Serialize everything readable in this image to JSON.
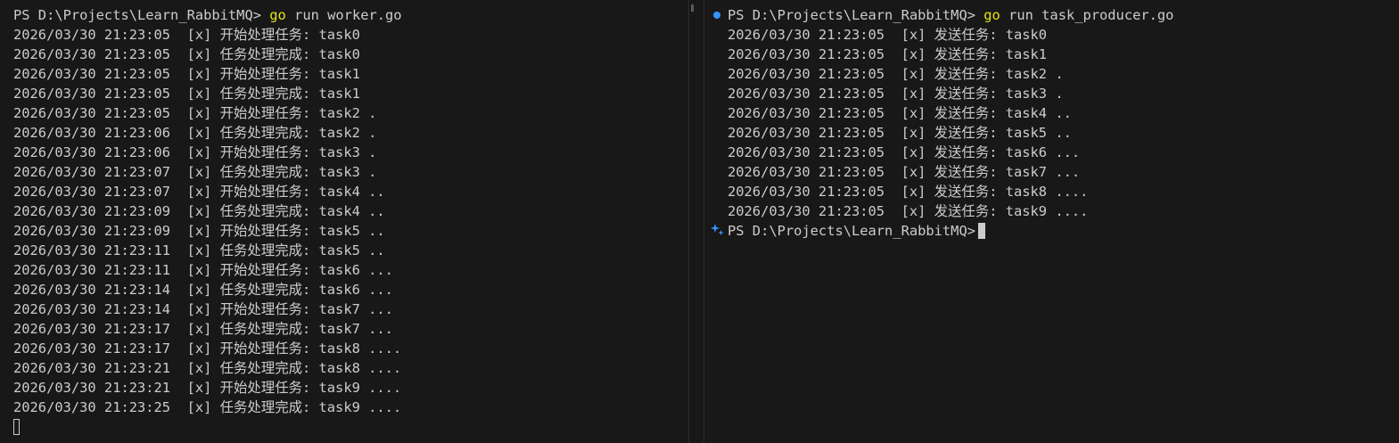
{
  "left_terminal": {
    "prompt": "PS D:\\Projects\\Learn_RabbitMQ>",
    "command": "go",
    "command_args": "run worker.go",
    "output": [
      "2026/03/30 21:23:05  [x] 开始处理任务: task0",
      "2026/03/30 21:23:05  [x] 任务处理完成: task0",
      "2026/03/30 21:23:05  [x] 开始处理任务: task1",
      "2026/03/30 21:23:05  [x] 任务处理完成: task1",
      "2026/03/30 21:23:05  [x] 开始处理任务: task2 .",
      "2026/03/30 21:23:06  [x] 任务处理完成: task2 .",
      "2026/03/30 21:23:06  [x] 开始处理任务: task3 .",
      "2026/03/30 21:23:07  [x] 任务处理完成: task3 .",
      "2026/03/30 21:23:07  [x] 开始处理任务: task4 ..",
      "2026/03/30 21:23:09  [x] 任务处理完成: task4 ..",
      "2026/03/30 21:23:09  [x] 开始处理任务: task5 ..",
      "2026/03/30 21:23:11  [x] 任务处理完成: task5 ..",
      "2026/03/30 21:23:11  [x] 开始处理任务: task6 ...",
      "2026/03/30 21:23:14  [x] 任务处理完成: task6 ...",
      "2026/03/30 21:23:14  [x] 开始处理任务: task7 ...",
      "2026/03/30 21:23:17  [x] 任务处理完成: task7 ...",
      "2026/03/30 21:23:17  [x] 开始处理任务: task8 ....",
      "2026/03/30 21:23:21  [x] 任务处理完成: task8 ....",
      "2026/03/30 21:23:21  [x] 开始处理任务: task9 ....",
      "2026/03/30 21:23:25  [x] 任务处理完成: task9 ...."
    ]
  },
  "right_terminal": {
    "prompt": "PS D:\\Projects\\Learn_RabbitMQ>",
    "command": "go",
    "command_args": "run task_producer.go",
    "output": [
      "2026/03/30 21:23:05  [x] 发送任务: task0",
      "2026/03/30 21:23:05  [x] 发送任务: task1",
      "2026/03/30 21:23:05  [x] 发送任务: task2 .",
      "2026/03/30 21:23:05  [x] 发送任务: task3 .",
      "2026/03/30 21:23:05  [x] 发送任务: task4 ..",
      "2026/03/30 21:23:05  [x] 发送任务: task5 ..",
      "2026/03/30 21:23:05  [x] 发送任务: task6 ...",
      "2026/03/30 21:23:05  [x] 发送任务: task7 ...",
      "2026/03/30 21:23:05  [x] 发送任务: task8 ....",
      "2026/03/30 21:23:05  [x] 发送任务: task9 ...."
    ],
    "final_prompt": "PS D:\\Projects\\Learn_RabbitMQ>"
  },
  "colors": {
    "background": "#181818",
    "text": "#cccccc",
    "command_highlight": "#e5e510",
    "command_decoration": "#3794ff"
  },
  "icons": {
    "command_decoration": "circle-dot-icon",
    "prompt_decoration": "sparkle-icon"
  }
}
